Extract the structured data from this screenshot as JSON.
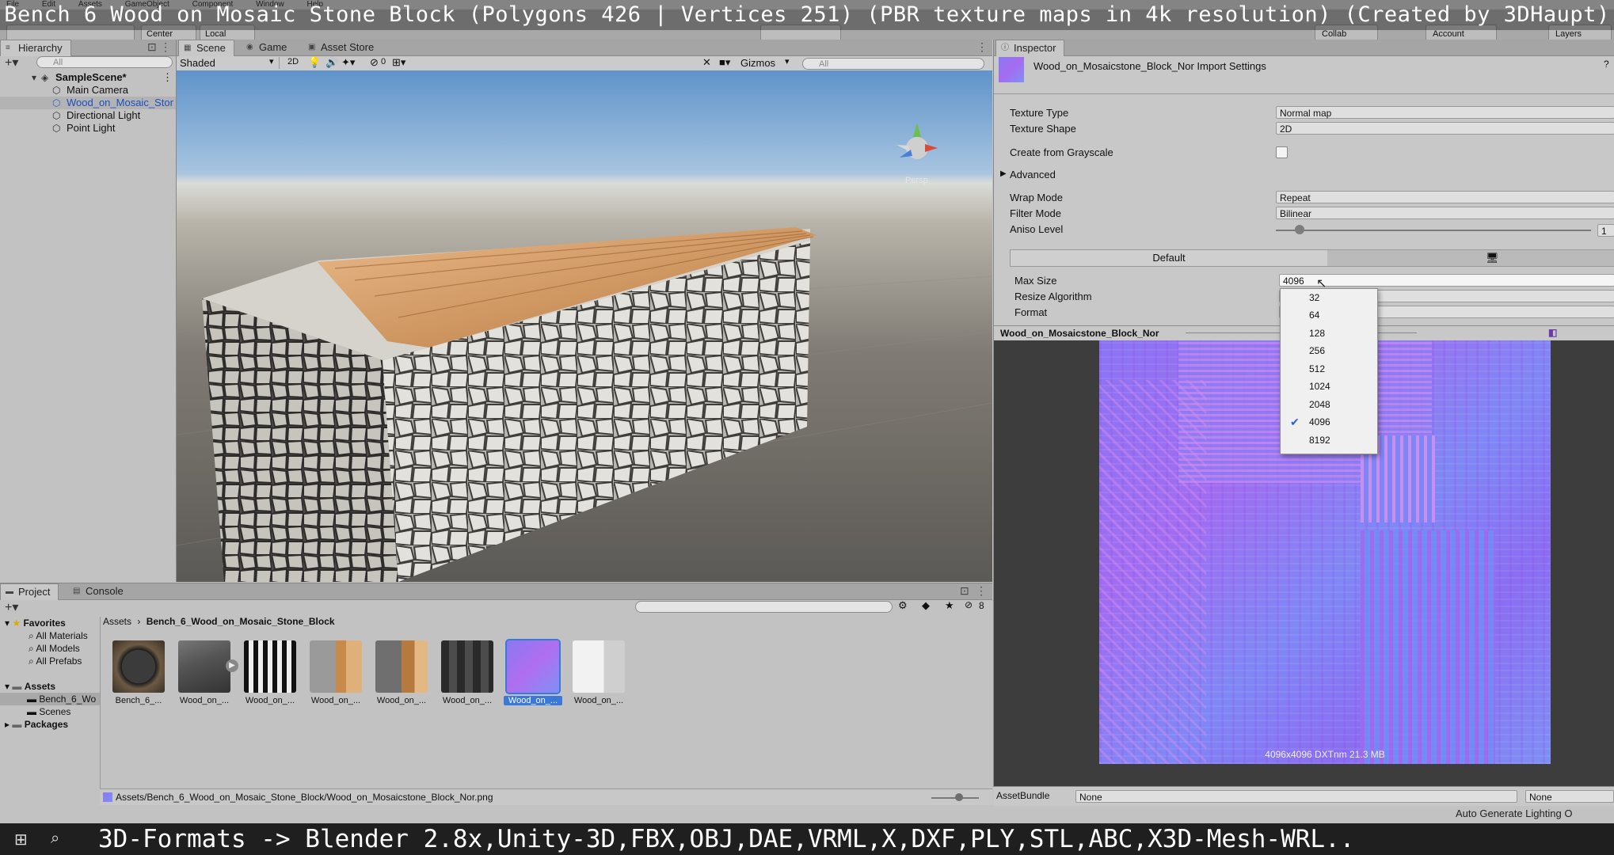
{
  "overlay": {
    "top_banner": "Bench 6 Wood on Mosaic Stone Block (Polygons 426 | Vertices 251) (PBR texture maps in 4k resolution) (Created by 3DHaupt)",
    "bottom_banner": "3D-Formats -> Blender 2.8x,Unity-3D,FBX,OBJ,DAE,VRML,X,DXF,PLY,STL,ABC,X3D-Mesh-WRL.."
  },
  "menubar": [
    "File",
    "Edit",
    "Assets",
    "GameObject",
    "Component",
    "Window",
    "Help"
  ],
  "toolbar": {
    "pivot": "Center",
    "space": "Local",
    "collab": "Collab",
    "account": "Account",
    "layers": "Layers"
  },
  "hierarchy": {
    "tab": "Hierarchy",
    "search_placeholder": "All",
    "scene": "SampleScene*",
    "items": [
      "Main Camera",
      "Wood_on_Mosaic_Stor",
      "Directional Light",
      "Point Light"
    ]
  },
  "scene": {
    "tabs": [
      "Scene",
      "Game",
      "Asset Store"
    ],
    "shading": "Shaded",
    "mode_2d": "2D",
    "hidden_count": "0",
    "gizmos": "Gizmos",
    "search_placeholder": "All",
    "persp_label": "Persp"
  },
  "inspector": {
    "tab": "Inspector",
    "title": "Wood_on_Mosaicstone_Block_Nor Import Settings",
    "fields": {
      "texture_type": {
        "label": "Texture Type",
        "value": "Normal map"
      },
      "texture_shape": {
        "label": "Texture Shape",
        "value": "2D"
      },
      "create_from_grayscale": {
        "label": "Create from Grayscale",
        "checked": false
      },
      "advanced": "Advanced",
      "wrap_mode": {
        "label": "Wrap Mode",
        "value": "Repeat"
      },
      "filter_mode": {
        "label": "Filter Mode",
        "value": "Bilinear"
      },
      "aniso_level": {
        "label": "Aniso Level",
        "value": "1"
      }
    },
    "platform_tab": "Default",
    "max_size": {
      "label": "Max Size",
      "value": "4096"
    },
    "resize_algorithm": {
      "label": "Resize Algorithm"
    },
    "format": {
      "label": "Format"
    },
    "max_size_options": [
      "32",
      "64",
      "128",
      "256",
      "512",
      "1024",
      "2048",
      "4096",
      "8192"
    ],
    "max_size_selected": "4096",
    "preview_title": "Wood_on_Mosaicstone_Block_Nor",
    "preview_info": "4096x4096 DXTnm 21.3 MB",
    "asset_bundle_label": "AssetBundle",
    "asset_bundle_value": "None",
    "asset_bundle_variant": "None",
    "auto_lighting": "Auto Generate Lighting O"
  },
  "project": {
    "tabs": [
      "Project",
      "Console"
    ],
    "hidden_count": "8",
    "favorites": {
      "label": "Favorites",
      "items": [
        "All Materials",
        "All Models",
        "All Prefabs"
      ]
    },
    "assets": {
      "label": "Assets",
      "items": [
        "Bench_6_Wo",
        "Scenes"
      ]
    },
    "packages": "Packages",
    "breadcrumb": [
      "Assets",
      "Bench_6_Wood_on_Mosaic_Stone_Block"
    ],
    "asset_items": [
      "Bench_6_...",
      "Wood_on_...",
      "Wood_on_...",
      "Wood_on_...",
      "Wood_on_...",
      "Wood_on_...",
      "Wood_on_...",
      "Wood_on_..."
    ],
    "selected_path": "Assets/Bench_6_Wood_on_Mosaic_Stone_Block/Wood_on_Mosaicstone_Block_Nor.png"
  }
}
